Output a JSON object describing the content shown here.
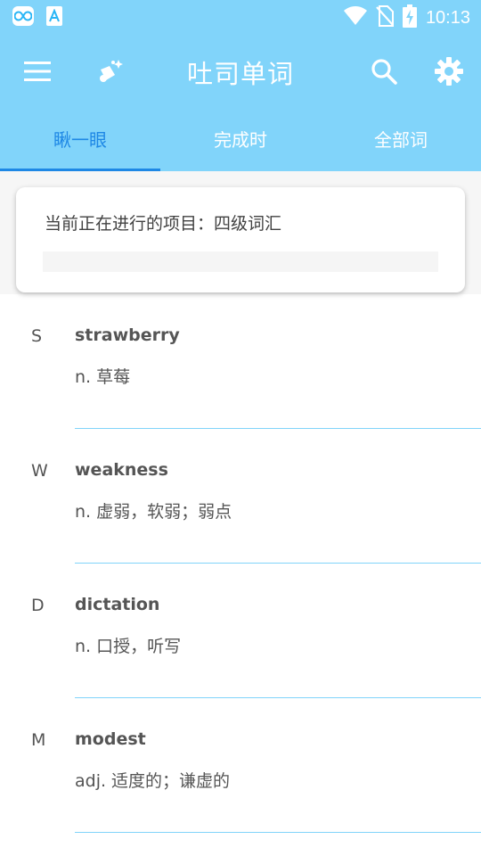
{
  "status_bar": {
    "time": "10:13",
    "left_icons": [
      "infinity-app-icon",
      "font-app-icon"
    ],
    "right_icons": [
      "wifi-icon",
      "no-sim-icon",
      "battery-charging-icon"
    ]
  },
  "app_bar": {
    "title": "吐司单词",
    "icons": [
      "menu-icon",
      "magic-wand-icon",
      "search-icon",
      "gear-icon"
    ]
  },
  "tabs": [
    {
      "label": "瞅一眼",
      "active": true
    },
    {
      "label": "完成时",
      "active": false
    },
    {
      "label": "全部词",
      "active": false
    }
  ],
  "current_project": {
    "text": "当前正在进行的项目：四级词汇",
    "progress": 0
  },
  "words": [
    {
      "letter": "S",
      "word": "strawberry",
      "meaning": "n. 草莓"
    },
    {
      "letter": "W",
      "word": "weakness",
      "meaning": "n. 虚弱，软弱；弱点"
    },
    {
      "letter": "D",
      "word": "dictation",
      "meaning": "n. 口授，听写"
    },
    {
      "letter": "M",
      "word": "modest",
      "meaning": "adj. 适度的；谦虚的"
    }
  ],
  "colors": {
    "primary": "#81d4fa",
    "accent": "#1e88e5",
    "text": "#555555"
  }
}
